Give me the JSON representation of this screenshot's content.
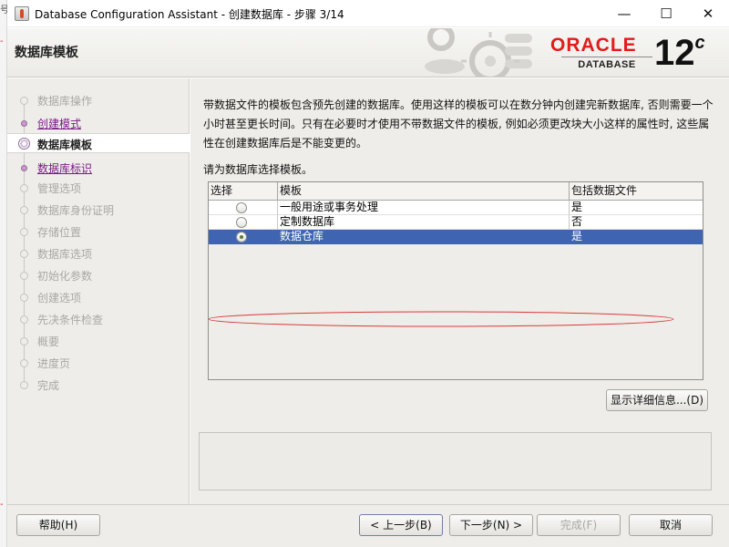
{
  "window": {
    "title": "Database Configuration Assistant - 创建数据库 - 步骤 3/14",
    "controls": {
      "minimize": "—",
      "maximize": "☐",
      "close": "✕"
    }
  },
  "background_fragments": [
    "号",
    "-",
    "-"
  ],
  "header": {
    "page_title": "数据库模板",
    "logo": {
      "brand": "ORACLE",
      "product": "DATABASE",
      "version": "12",
      "version_suffix": "c"
    }
  },
  "nav": {
    "items": [
      {
        "label": "数据库操作",
        "state": "todo"
      },
      {
        "label": "创建模式",
        "state": "done"
      },
      {
        "label": "数据库模板",
        "state": "current"
      },
      {
        "label": "数据库标识",
        "state": "done"
      },
      {
        "label": "管理选项",
        "state": "todo"
      },
      {
        "label": "数据库身份证明",
        "state": "todo"
      },
      {
        "label": "存储位置",
        "state": "todo"
      },
      {
        "label": "数据库选项",
        "state": "todo"
      },
      {
        "label": "初始化参数",
        "state": "todo"
      },
      {
        "label": "创建选项",
        "state": "todo"
      },
      {
        "label": "先决条件检查",
        "state": "todo"
      },
      {
        "label": "概要",
        "state": "todo"
      },
      {
        "label": "进度页",
        "state": "todo"
      },
      {
        "label": "完成",
        "state": "todo"
      }
    ]
  },
  "main": {
    "description": "带数据文件的模板包含预先创建的数据库。使用这样的模板可以在数分钟内创建完新数据库, 否则需要一个小时甚至更长时间。只有在必要时才使用不带数据文件的模板, 例如必须更改块大小这样的属性时, 这些属性在创建数据库后是不能变更的。",
    "prompt": "请为数据库选择模板。",
    "table": {
      "columns": [
        "选择",
        "模板",
        "包括数据文件"
      ],
      "rows": [
        {
          "selected": false,
          "template": "一般用途或事务处理",
          "includes_datafiles": "是"
        },
        {
          "selected": false,
          "template": "定制数据库",
          "includes_datafiles": "否"
        },
        {
          "selected": true,
          "template": "数据仓库",
          "includes_datafiles": "是"
        }
      ]
    },
    "details_button": "显示详细信息...(D)"
  },
  "buttons": {
    "help": "帮助(H)",
    "back": "< 上一步(B)",
    "next": "下一步(N) >",
    "finish": "完成(F)",
    "cancel": "取消"
  },
  "colors": {
    "selection": "#3f65b1",
    "nav_done": "#7a1a86",
    "nav_todo": "#a9a8a3",
    "oracle_red": "#e21b1b",
    "annotation_ellipse": "#d93a3a"
  }
}
